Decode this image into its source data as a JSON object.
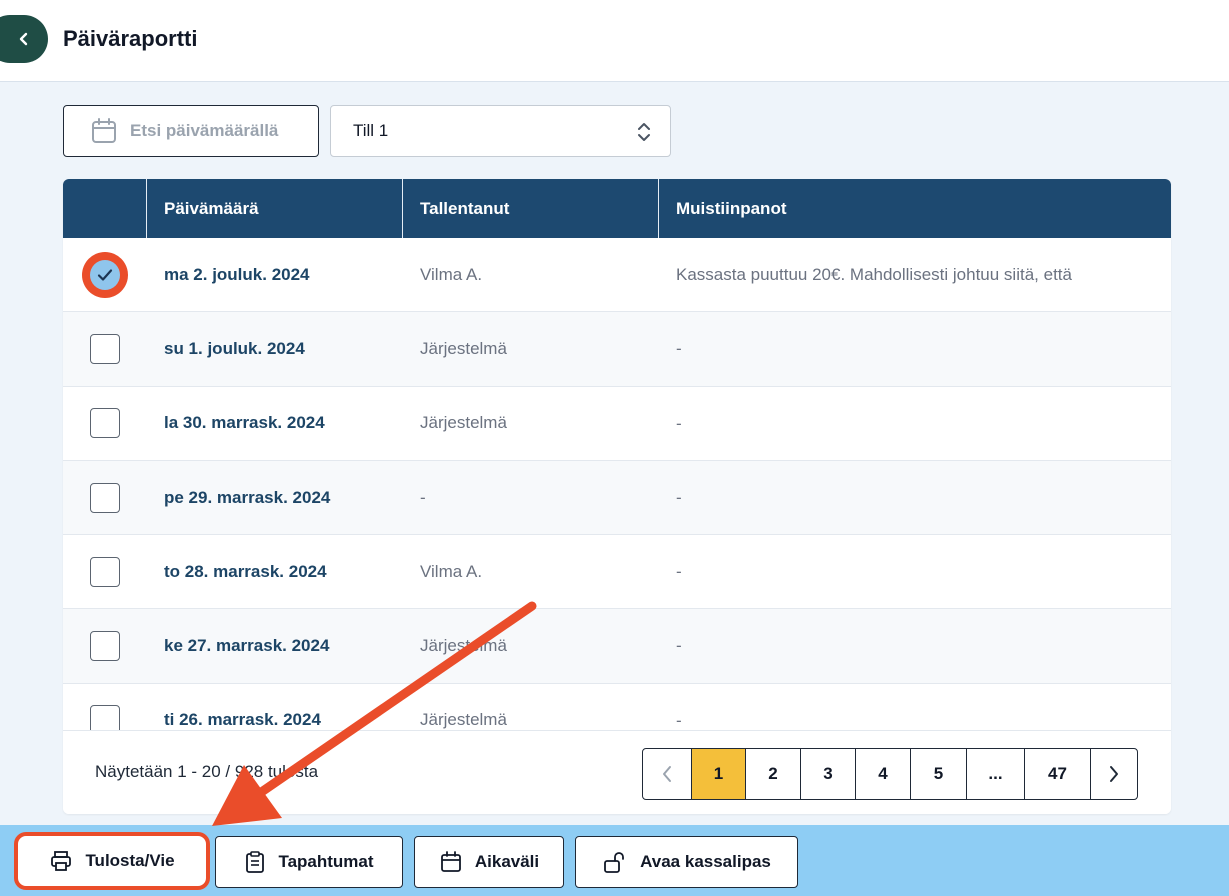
{
  "header": {
    "title": "Päiväraportti"
  },
  "filters": {
    "date_search_label": "Etsi päivämäärällä",
    "till_selected": "Till 1"
  },
  "table": {
    "columns": [
      "Päivämäärä",
      "Tallentanut",
      "Muistiinpanot"
    ],
    "rows": [
      {
        "date": "ma 2. jouluk. 2024",
        "saved_by": "Vilma A.",
        "notes": "Kassasta puuttuu 20€. Mahdollisesti johtuu siitä, että",
        "checked": true
      },
      {
        "date": "su 1. jouluk. 2024",
        "saved_by": "Järjestelmä",
        "notes": "-",
        "checked": false
      },
      {
        "date": "la 30. marrask. 2024",
        "saved_by": "Järjestelmä",
        "notes": "-",
        "checked": false
      },
      {
        "date": "pe 29. marrask. 2024",
        "saved_by": "-",
        "notes": "-",
        "checked": false
      },
      {
        "date": "to 28. marrask. 2024",
        "saved_by": "Vilma A.",
        "notes": "-",
        "checked": false
      },
      {
        "date": "ke 27. marrask. 2024",
        "saved_by": "Järjestelmä",
        "notes": "-",
        "checked": false
      },
      {
        "date": "ti 26. marrask. 2024",
        "saved_by": "Järjestelmä",
        "notes": "-",
        "checked": false
      }
    ]
  },
  "pagination": {
    "summary": "Näytetään 1 - 20 / 928 tulosta",
    "pages": [
      "1",
      "2",
      "3",
      "4",
      "5",
      "...",
      "47"
    ],
    "active_page": "1"
  },
  "actions": {
    "print_export": "Tulosta/Vie",
    "events": "Tapahtumat",
    "time_range": "Aikaväli",
    "open_drawer": "Avaa kassalipas"
  },
  "colors": {
    "header_bg": "#1d4970",
    "accent_yellow": "#f4bf3a",
    "bottom_bar": "#8ecdf4",
    "annotation_red": "#ea4d2a"
  }
}
